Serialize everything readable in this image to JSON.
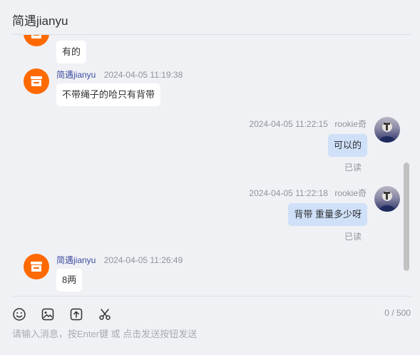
{
  "header": {
    "title": "简遇jianyu"
  },
  "messages": [
    {
      "text": "有的"
    },
    {
      "sender": "简遇jianyu",
      "time": "2024-04-05 11:19:38",
      "text": "不带绳子的哈只有背带"
    },
    {
      "sender": "rookie奇",
      "time": "2024-04-05 11:22:15",
      "text": "可以的",
      "status": "已读"
    },
    {
      "sender": "rookie奇",
      "time": "2024-04-05 11:22:18",
      "text": "背带 重量多少呀",
      "status": "已读"
    },
    {
      "sender": "简遇jianyu",
      "time": "2024-04-05 11:26:49",
      "text": "8两"
    }
  ],
  "toolbar": {
    "icons": [
      "emoji-icon",
      "image-icon",
      "upload-icon",
      "scissors-icon"
    ],
    "counter": "0 / 500"
  },
  "input": {
    "placeholder": "请输入消息，按Enter键 或 点击发送按钮发送",
    "value": ""
  },
  "colors": {
    "shop_avatar": "#ff6a00",
    "right_bubble": "#cfe0f8",
    "left_bubble": "#ffffff",
    "sender_name": "#3f4ea1"
  }
}
